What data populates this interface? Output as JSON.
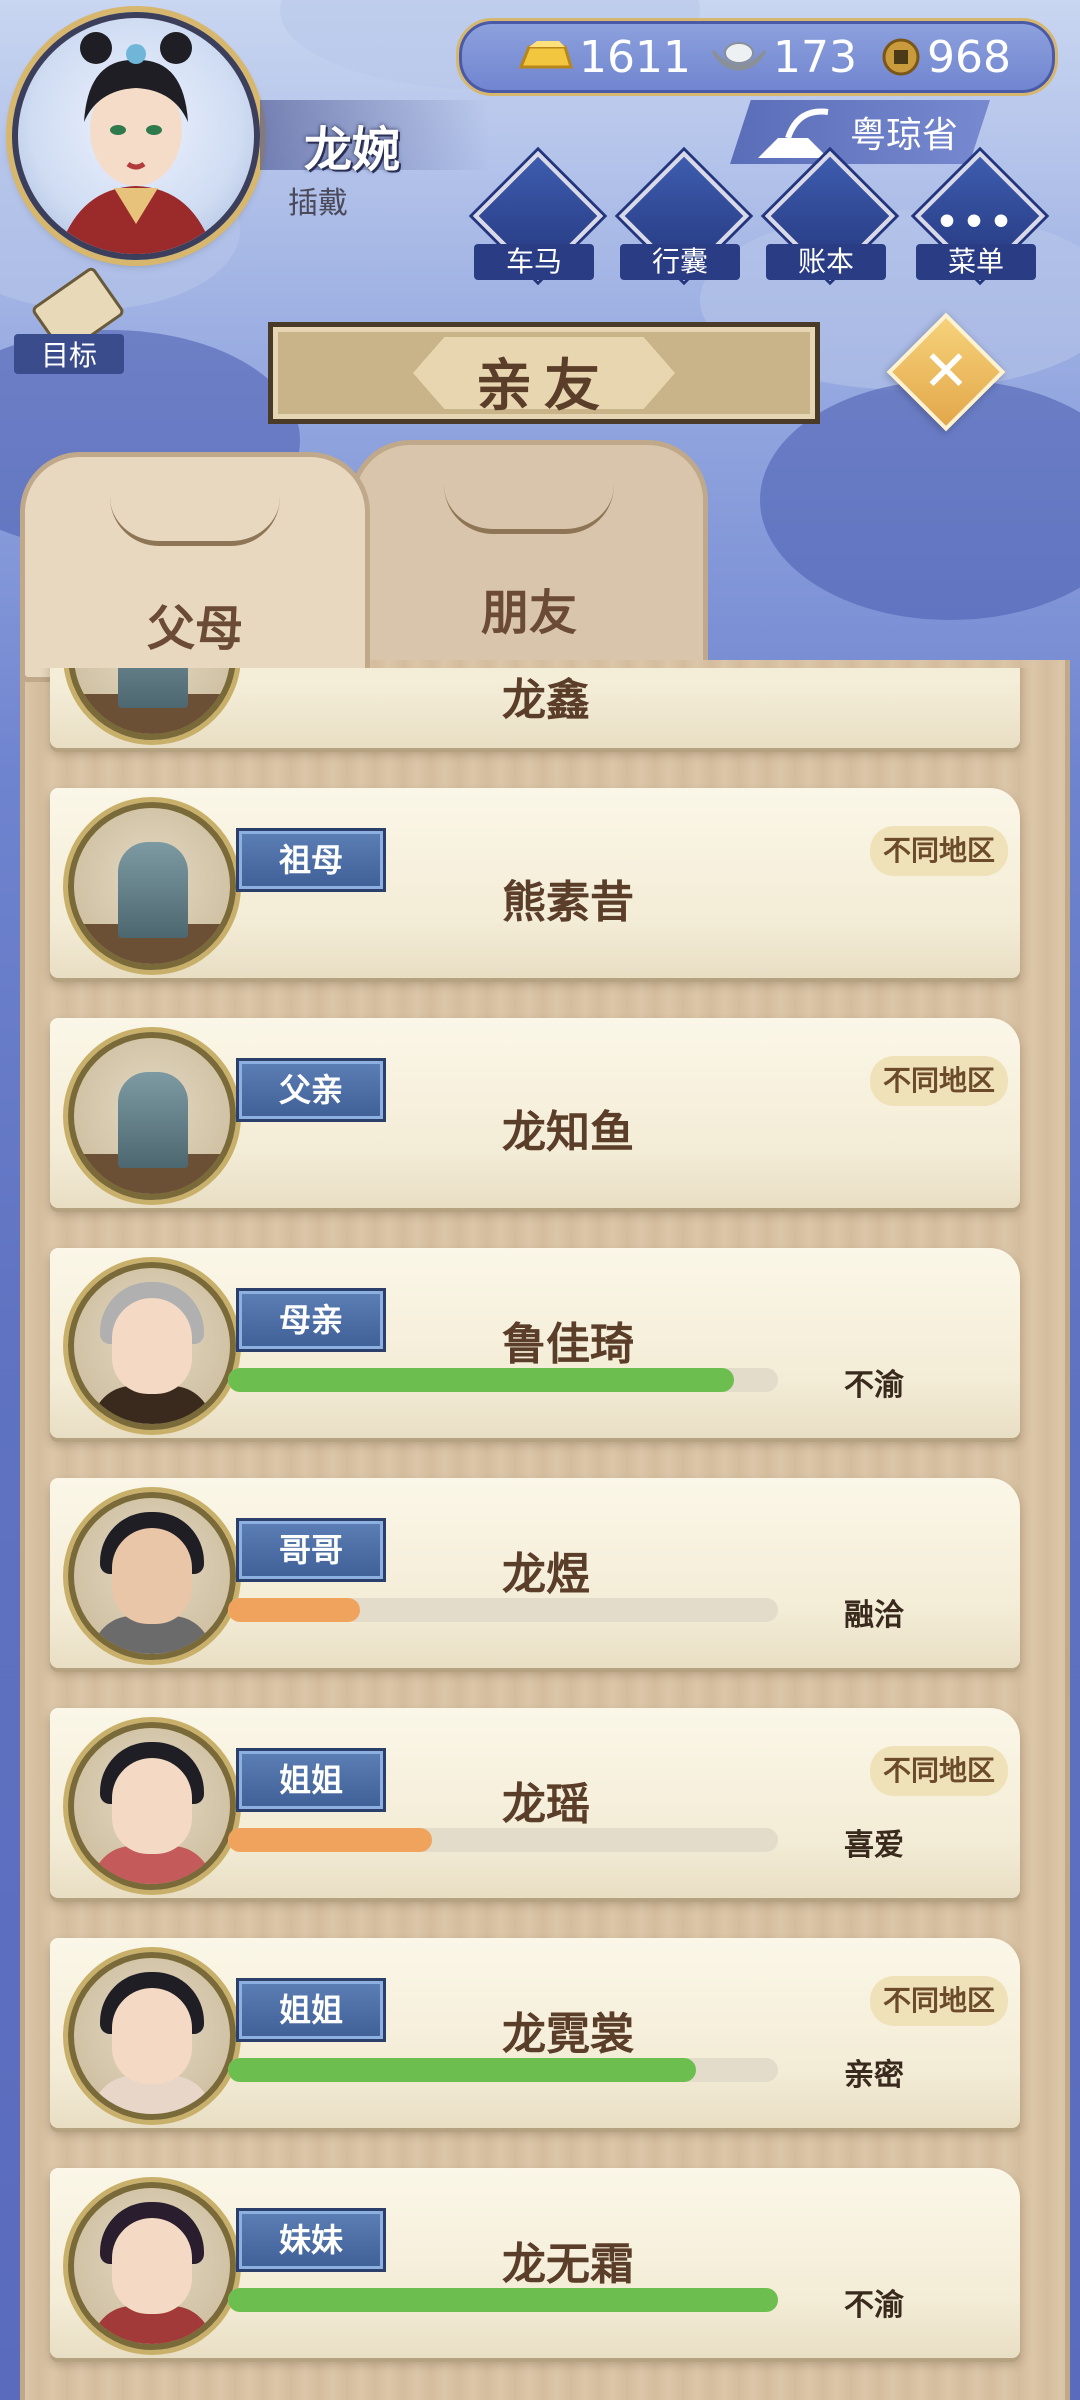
{
  "player": {
    "name": "龙婉",
    "title": "插戴"
  },
  "currency": {
    "gold": "1611",
    "silver": "173",
    "copper": "968"
  },
  "region": "粤琼省",
  "nav": [
    {
      "label": "车马",
      "icon": "carriage-icon"
    },
    {
      "label": "行囊",
      "icon": "bag-icon"
    },
    {
      "label": "账本",
      "icon": "ledger-icon"
    },
    {
      "label": "菜单",
      "icon": "menu-dots-icon"
    }
  ],
  "target_label": "目标",
  "page_title": "亲友",
  "tabs": [
    {
      "label": "父母",
      "active": true
    },
    {
      "label": "朋友",
      "active": false
    }
  ],
  "relatives": [
    {
      "relation": "",
      "name": "龙鑫",
      "deceased": true,
      "region_badge": "",
      "affinity_label": "",
      "affinity_level": null,
      "bar_color": ""
    },
    {
      "relation": "祖母",
      "name": "熊素昔",
      "deceased": true,
      "region_badge": "不同地区",
      "affinity_label": "",
      "affinity_level": null,
      "bar_color": ""
    },
    {
      "relation": "父亲",
      "name": "龙知鱼",
      "deceased": true,
      "region_badge": "不同地区",
      "affinity_label": "",
      "affinity_level": null,
      "bar_color": ""
    },
    {
      "relation": "母亲",
      "name": "鲁佳琦",
      "deceased": false,
      "region_badge": "",
      "affinity_label": "不渝",
      "affinity_level": 0.92,
      "bar_color": "#6cbf4f"
    },
    {
      "relation": "哥哥",
      "name": "龙煜",
      "deceased": false,
      "region_badge": "",
      "affinity_label": "融洽",
      "affinity_level": 0.24,
      "bar_color": "#f0a35c"
    },
    {
      "relation": "姐姐",
      "name": "龙瑶",
      "deceased": false,
      "region_badge": "不同地区",
      "affinity_label": "喜爱",
      "affinity_level": 0.37,
      "bar_color": "#f0a35c"
    },
    {
      "relation": "姐姐",
      "name": "龙霓裳",
      "deceased": false,
      "region_badge": "不同地区",
      "affinity_label": "亲密",
      "affinity_level": 0.85,
      "bar_color": "#6cbf4f"
    },
    {
      "relation": "妹妹",
      "name": "龙无霜",
      "deceased": false,
      "region_badge": "",
      "affinity_label": "不渝",
      "affinity_level": 1.0,
      "bar_color": "#6cbf4f"
    }
  ],
  "colors": {
    "accent_gold": "#d7b76d",
    "tag_blue": "#3f5f97",
    "bar_green": "#6cbf4f",
    "bar_orange": "#f0a35c"
  }
}
